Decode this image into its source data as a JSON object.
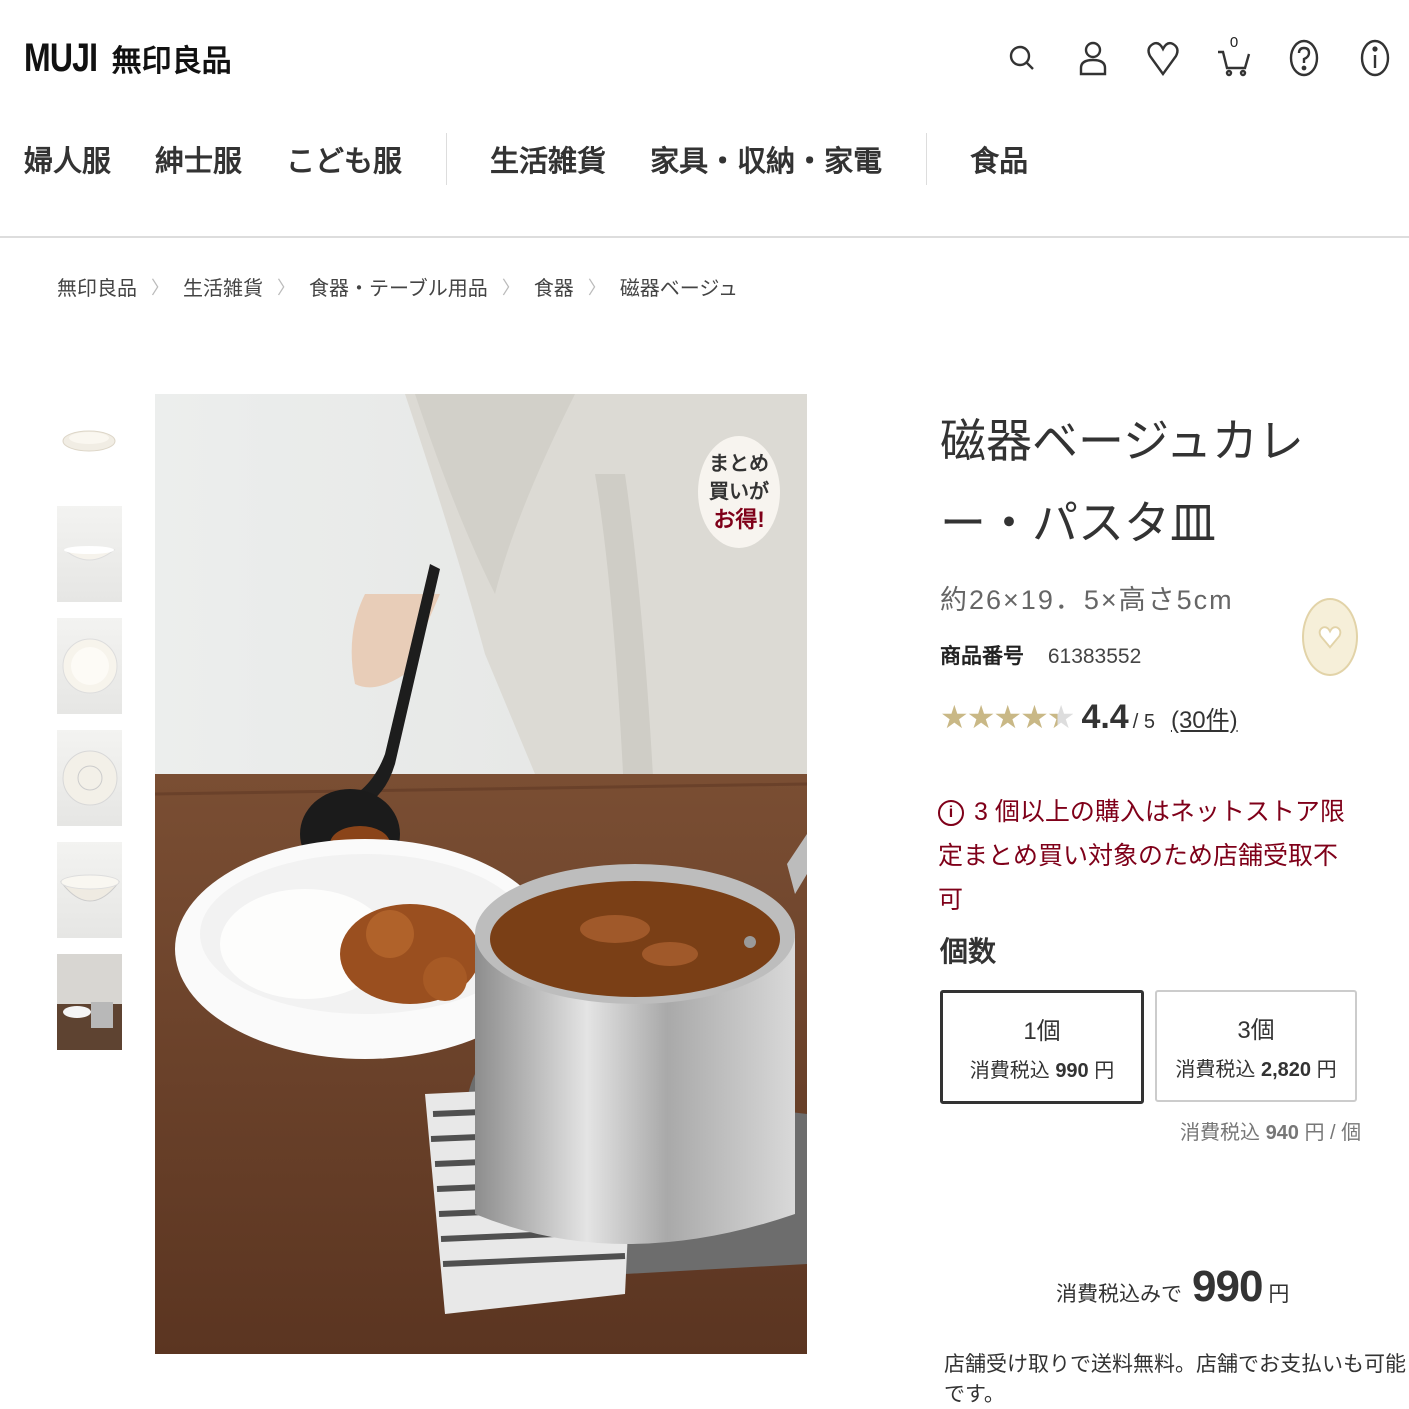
{
  "header": {
    "logo_en": "MUJI",
    "logo_jp": "無印良品",
    "cart_count": "0",
    "icons": [
      "search-icon",
      "account-icon",
      "favorite-icon",
      "cart-icon",
      "help-icon",
      "info-icon"
    ]
  },
  "nav": {
    "items": [
      "婦人服",
      "紳士服",
      "こども服",
      "生活雑貨",
      "家具・収納・家電",
      "食品"
    ]
  },
  "breadcrumb": [
    "無印良品",
    "生活雑貨",
    "食器・テーブル用品",
    "食器",
    "磁器ベージュ"
  ],
  "gallery": {
    "badge_line1": "まとめ",
    "badge_line2": "買いが",
    "badge_line3": "お得!"
  },
  "product": {
    "title": "磁器ベージュカレー・パスタ皿",
    "size": "約26×19．5×高さ5cm",
    "number_label": "商品番号",
    "number": "61383552",
    "rating": "4.4",
    "rating_max": "/ 5",
    "review_count": "(30件)",
    "notice": "3 個以上の購入はネットストア限定まとめ買い対象のため店舗受取不可"
  },
  "quantity": {
    "label": "個数",
    "options": [
      {
        "qty": "1個",
        "tax_label": "消費税込",
        "price": "990",
        "yen": "円"
      },
      {
        "qty": "3個",
        "tax_label": "消費税込",
        "price": "2,820",
        "yen": "円"
      }
    ],
    "per_unit_label": "消費税込",
    "per_unit_price": "940",
    "per_unit_suffix": "円 / 個"
  },
  "total": {
    "label": "消費税込みで",
    "amount": "990",
    "yen": "円"
  },
  "store_note": "店舗受け取りで送料無料。店舗でお支払いも可能です。",
  "colors": {
    "accent_red": "#7f0019",
    "favorite_gold": "#e2d3a8"
  }
}
